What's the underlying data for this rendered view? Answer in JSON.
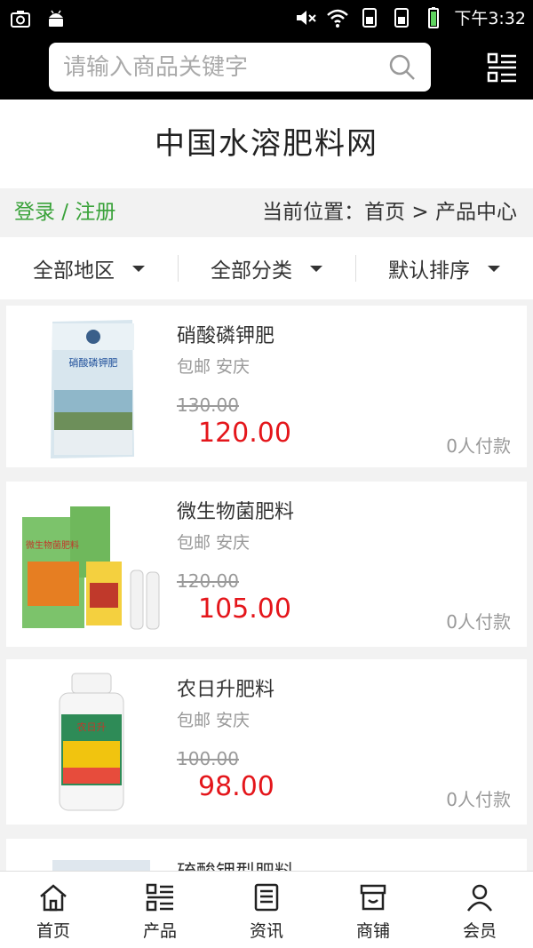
{
  "status_bar": {
    "time": "下午3:32"
  },
  "search": {
    "placeholder": "请输入商品关键字"
  },
  "site_title": "中国水溶肥料网",
  "breadcrumb": {
    "login": "登录 / 注册",
    "location": "当前位置：首页 > 产品中心"
  },
  "filters": [
    "全部地区",
    "全部分类",
    "默认排序"
  ],
  "products": [
    {
      "name": "硝酸磷钾肥",
      "tag": "包邮 安庆",
      "old_price": "130.00",
      "price": "120.00",
      "sold": "0人付款",
      "image_text": "硝酸磷钾肥"
    },
    {
      "name": "微生物菌肥料",
      "tag": "包邮 安庆",
      "old_price": "120.00",
      "price": "105.00",
      "sold": "0人付款",
      "image_text": "微生物菌肥料"
    },
    {
      "name": "农日升肥料",
      "tag": "包邮 安庆",
      "old_price": "100.00",
      "price": "98.00",
      "sold": "0人付款",
      "image_text": "农日升"
    },
    {
      "name": "硫酸钾型肥料",
      "tag": "",
      "old_price": "",
      "price": "",
      "sold": "",
      "image_text": ""
    }
  ],
  "bottom_nav": [
    "首页",
    "产品",
    "资讯",
    "商铺",
    "会员"
  ],
  "colors": {
    "accent_green": "#3aa23a",
    "price_red": "#e4161b"
  }
}
